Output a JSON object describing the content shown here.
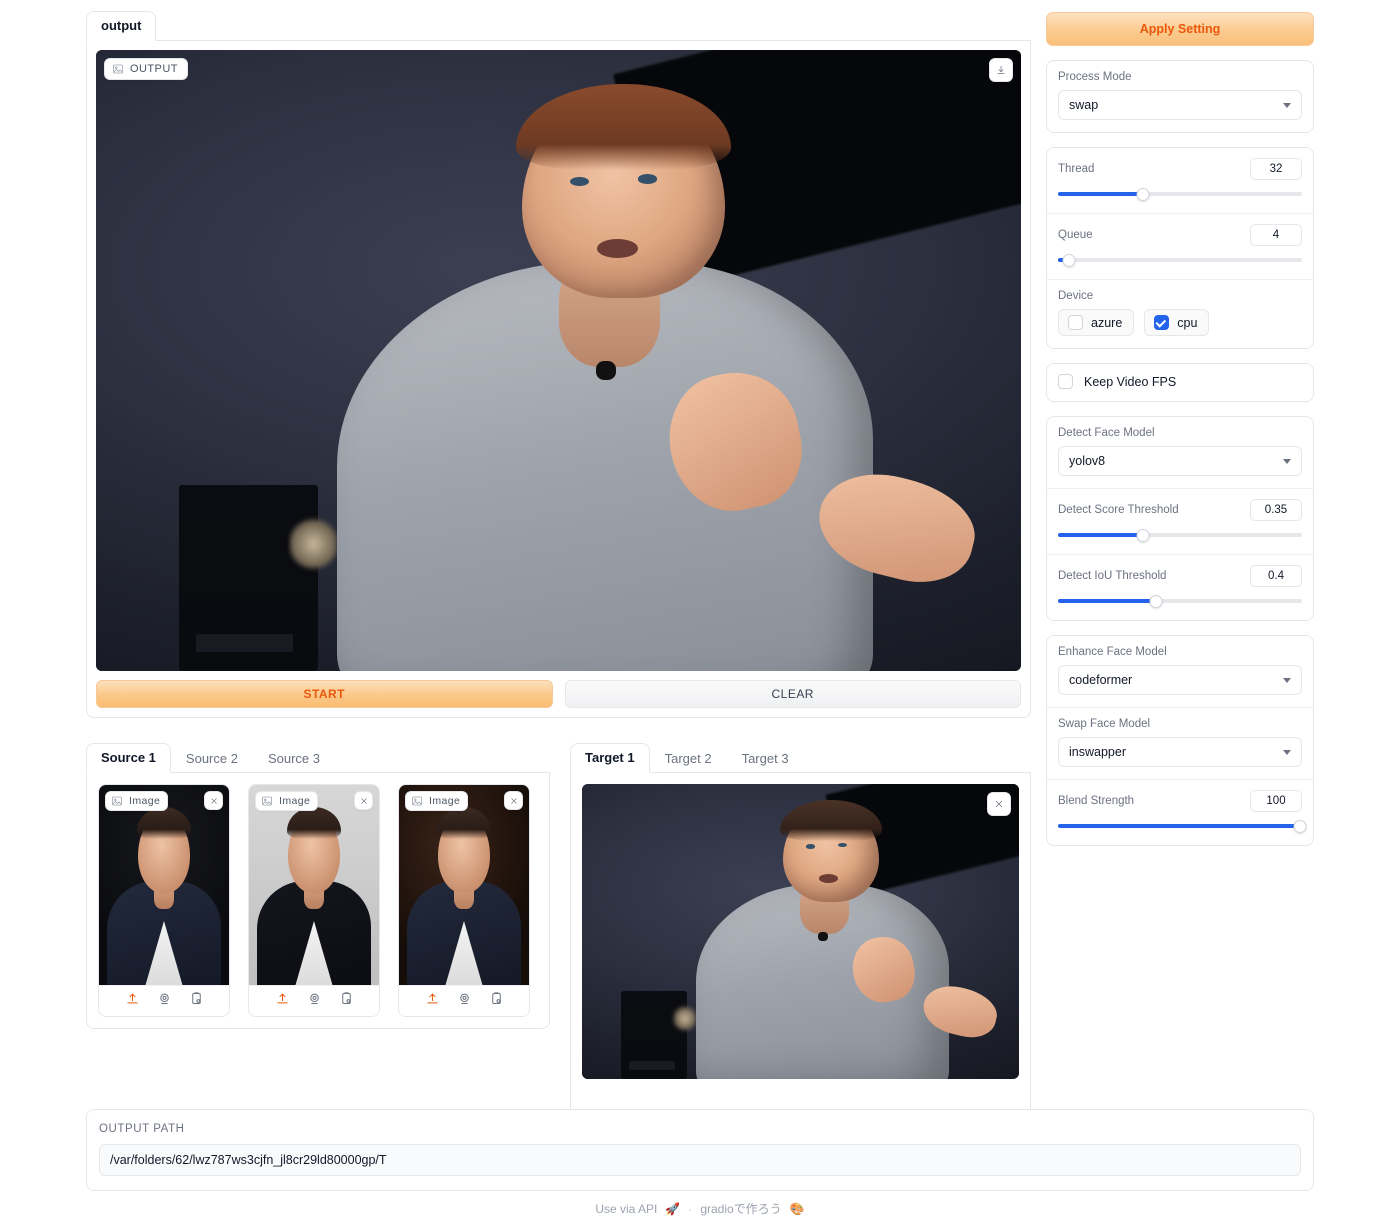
{
  "output_group": {
    "tab_label": "output",
    "image_badge": "OUTPUT",
    "download_icon": "download-icon",
    "image_alt": "man in grey sweater gesturing on dark stage, face-swapped result"
  },
  "actions": {
    "start_label": "START",
    "clear_label": "CLEAR"
  },
  "source_panel": {
    "tabs": [
      {
        "label": "Source 1",
        "active": true
      },
      {
        "label": "Source 2",
        "active": false
      },
      {
        "label": "Source 3",
        "active": false
      }
    ],
    "thumbs": [
      {
        "badge": "Image",
        "close_icon": "close-icon",
        "alt": "man in dark suit with hands clasped on black background"
      },
      {
        "badge": "Image",
        "close_icon": "close-icon",
        "alt": "man in black tuxedo and white shirt on light grey background"
      },
      {
        "badge": "Image",
        "close_icon": "close-icon",
        "alt": "man in dark suit with white scarf, warm dark background"
      }
    ],
    "tools": [
      {
        "name": "upload-icon",
        "title": "Upload"
      },
      {
        "name": "webcam-icon",
        "title": "Webcam"
      },
      {
        "name": "paste-icon",
        "title": "Paste from clipboard"
      }
    ]
  },
  "target_panel": {
    "tabs": [
      {
        "label": "Target 1",
        "active": true
      },
      {
        "label": "Target 2",
        "active": false
      },
      {
        "label": "Target 3",
        "active": false
      }
    ],
    "close_icon": "close-icon",
    "image_alt": "man in grey sweater gesturing on dark stage",
    "tools": [
      {
        "name": "upload-icon",
        "title": "Upload"
      },
      {
        "name": "webcam-icon",
        "title": "Webcam"
      },
      {
        "name": "paste-icon",
        "title": "Paste from clipboard"
      }
    ]
  },
  "output_path": {
    "label": "OUTPUT PATH",
    "value": "/var/folders/62/lwz787ws3cjfn_jl8cr29ld80000gp/T"
  },
  "footer": {
    "api_label": "Use via API",
    "api_icon": "rocket-icon",
    "separator": "·",
    "built_with": "gradioで作ろう",
    "built_icon": "palette-icon"
  },
  "settings": {
    "apply_label": "Apply Setting",
    "process_mode": {
      "label": "Process Mode",
      "value": "swap"
    },
    "thread": {
      "label": "Thread",
      "value": "32",
      "percent": 35
    },
    "queue": {
      "label": "Queue",
      "value": "4",
      "percent": 4
    },
    "device": {
      "label": "Device",
      "options": [
        {
          "label": "azure",
          "checked": false
        },
        {
          "label": "cpu",
          "checked": true
        }
      ]
    },
    "keep_video_fps": {
      "label": "Keep Video FPS",
      "checked": false
    },
    "detect_face_model": {
      "label": "Detect Face Model",
      "value": "yolov8"
    },
    "detect_score_threshold": {
      "label": "Detect Score Threshold",
      "value": "0.35",
      "percent": 35
    },
    "detect_iou_threshold": {
      "label": "Detect IoU Threshold",
      "value": "0.4",
      "percent": 40
    },
    "enhance_face_model": {
      "label": "Enhance Face Model",
      "value": "codeformer"
    },
    "swap_face_model": {
      "label": "Swap Face Model",
      "value": "inswapper"
    },
    "blend_strength": {
      "label": "Blend Strength",
      "value": "100",
      "percent": 100
    }
  },
  "colors": {
    "accent_orange": "#ea580c",
    "slider_blue": "#2563eb",
    "checkbox_blue": "#2563eb",
    "border": "#e5e7eb",
    "muted_text": "#6b7280"
  }
}
